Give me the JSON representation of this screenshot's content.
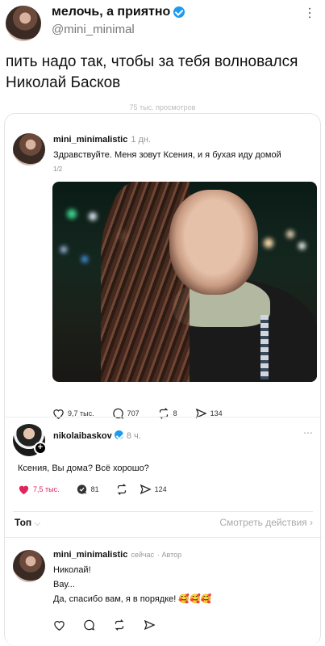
{
  "tweet": {
    "name": "мелочь, а приятно",
    "handle": "@mini_minimal",
    "text": "пить надо так, чтобы за тебя волновался Николай Басков",
    "faded_text": "75 тыс. просмотров"
  },
  "post1": {
    "username": "mini_minimalistic",
    "time": "1 дн.",
    "text": "Здравствуйте. Меня зовут Ксения, и я бухая иду домой",
    "page": "1/2",
    "likes": "9,7 тыс.",
    "comments": "707",
    "reposts": "8",
    "shares": "134"
  },
  "post2": {
    "username": "nikolaibaskov",
    "time": "8 ч.",
    "text": "Ксения, Вы дома? Всё хорошо?",
    "likes": "7,5 тыс.",
    "comments": "81",
    "shares": "124",
    "like_color": "#e0245e"
  },
  "filter": {
    "label": "Топ",
    "chevron": "⌵",
    "see_activity": "Смотреть действия",
    "see_chevron": "›"
  },
  "post3": {
    "username": "mini_minimalistic",
    "time": "сейчас",
    "author_tag": "· Автор",
    "lines": [
      "Николай!",
      "Вау...",
      "Да, спасибо вам, я в порядке! 🥰🥰🥰"
    ]
  },
  "more_icon": "⋯",
  "colors": {
    "verified": "#1d9bf0",
    "like": "#e0245e"
  }
}
